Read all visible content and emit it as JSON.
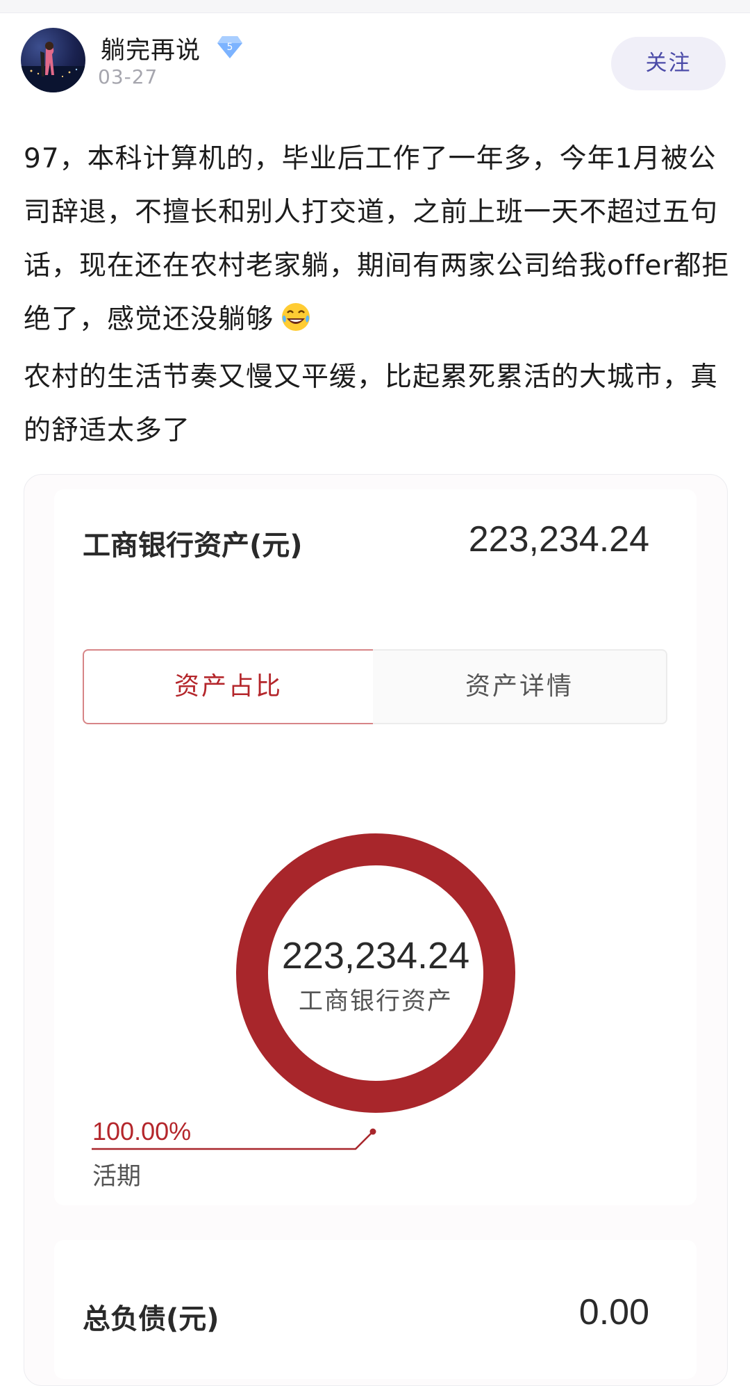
{
  "post_header": {
    "username": "躺完再说",
    "level_badge": "5",
    "date": "03-27",
    "follow_label": "关注"
  },
  "post_body": {
    "text": "97，本科计算机的，毕业后工作了一年多，今年1月被公司辞退，不擅长和别人打交道，之前上班一天不超过五句话，现在还在农村老家躺，期间有两家公司给我offer都拒绝了，感觉还没躺够",
    "emoji": "face-with-tears-of-joy",
    "text2": "农村的生活节奏又慢又平缓，比起累死累活的大城市，真的舒适太多了"
  },
  "asset_card": {
    "bank_label": "工商银行资产(元)",
    "bank_value": "223,234.24",
    "tabs": [
      {
        "label": "资产占比",
        "active": true
      },
      {
        "label": "资产详情",
        "active": false
      }
    ],
    "accent_color": "#a8262b"
  },
  "chart_data": {
    "type": "pie",
    "variant": "donut",
    "center_value": "223,234.24",
    "center_label": "工商银行资产",
    "slices": [
      {
        "label": "活期",
        "percent_label": "100.00%",
        "value": 100.0,
        "color": "#a8262b"
      }
    ]
  },
  "debt_card": {
    "label": "总负债(元)",
    "value": "0.00"
  }
}
